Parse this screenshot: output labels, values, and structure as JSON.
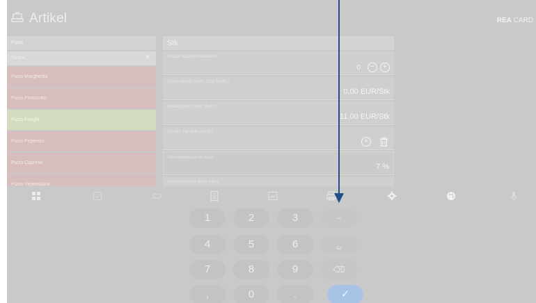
{
  "header": {
    "title": "Artikel",
    "brand_bold": "REA",
    "brand_light": " CARD"
  },
  "list": {
    "category": "Pizza",
    "search_placeholder": "Suche...",
    "clear_symbol": "×",
    "items": [
      {
        "label": "Pizza Margherita",
        "state": "normal"
      },
      {
        "label": "Pizza Prosciutto",
        "state": "normal"
      },
      {
        "label": "Pizza Funghi",
        "state": "selected"
      },
      {
        "label": "Pizza Peperoni",
        "state": "normal"
      },
      {
        "label": "Pizza Caprese",
        "state": "normal"
      },
      {
        "label": "Pizza Vegetaliana",
        "state": "normal"
      }
    ]
  },
  "detail": {
    "unit": "Stk",
    "fields": {
      "decimals": {
        "label": "Anzahl Nachkommastellen",
        "value": "0"
      },
      "purchase": {
        "label": "Einkaufspreis (netto, zzgl. MwSt.)",
        "value": "0,00 EUR/Stk"
      },
      "sale": {
        "label": "Verkaufspreis (inkl. MwSt.)",
        "value": "11,00 EUR/Stk"
      },
      "schoko": {
        "label": "Schoko Tag (inkl. MwSt.)"
      },
      "vat_in": {
        "label": "Mehrwertsteuer im Haus",
        "value": "7 %"
      },
      "vat_out": {
        "label": "Mehrwertsteuer außer Haus"
      }
    }
  },
  "iconbar": [
    "grid-icon",
    "box-icon",
    "tag-icon",
    "list-icon",
    "image-icon",
    "printer-icon",
    "gear-icon",
    "palette-icon",
    "microphone-icon"
  ],
  "keypad": {
    "keys": [
      "1",
      "2",
      "3",
      "−",
      "4",
      "5",
      "6",
      "␣",
      "7",
      "8",
      "9",
      "⌫",
      ",",
      "0",
      ".",
      "✓"
    ]
  },
  "colors": {
    "overlay": "#c9c9c9",
    "item_red": "#d7bdbd",
    "item_green": "#d4dcc0",
    "ok_blue": "#a9c3e6",
    "pointer": "#1f4f86"
  }
}
